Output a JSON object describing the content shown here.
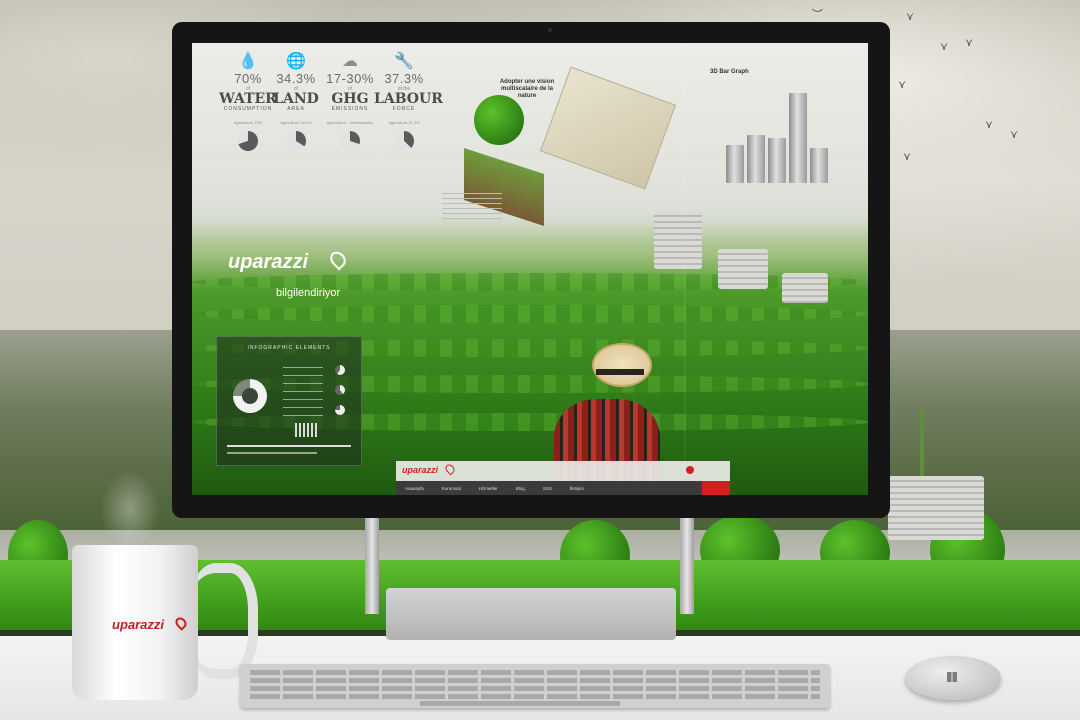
{
  "screen": {
    "stats": [
      {
        "icon": "water-drop-icon",
        "glyph": "💧",
        "percent": "70%",
        "of": "of",
        "title": "WATER",
        "subtitle": "CONSUMPTION",
        "note": "Agriculture 70%",
        "fill": 0.7
      },
      {
        "icon": "globe-icon",
        "glyph": "🌐",
        "percent": "34.3%",
        "of": "of",
        "title": "LAND",
        "subtitle": "AREA",
        "note": "Agriculture 34.3%",
        "fill": 0.343
      },
      {
        "icon": "cloud-icon",
        "glyph": "☁",
        "percent": "17-30%",
        "of": "of",
        "title": "GHG",
        "subtitle": "EMISSIONS",
        "note": "Agriculture · Deforestation",
        "fill": 0.3
      },
      {
        "icon": "wrench-icon",
        "glyph": "🔧",
        "percent": "37.3%",
        "of": "of the",
        "title": "LABOUR",
        "subtitle": "FORCE",
        "note": "Agriculture 37.3%",
        "fill": 0.373
      }
    ],
    "vision_title": "Adopter une vision multiscalaire de la nature",
    "chart_title": "3D Bar Graph",
    "chart_bar_levels": [
      0.38,
      0.48,
      0.45,
      0.9,
      0.35
    ],
    "brand": "uparazzi",
    "tagline": "bilgilendiriyor",
    "infographic_title": "INFOGRAPHIC ELEMENTS",
    "navbar": {
      "logo": "uparazzi",
      "menu": [
        "Anasayfa",
        "Kurumsal",
        "Hizmetler",
        "Blog",
        "SSS",
        "İletişim"
      ]
    }
  },
  "mug": {
    "logo": "uparazzi"
  },
  "colors": {
    "accent_red": "#d21f1f",
    "grass": "#4aa524",
    "monitor_frame": "#151515"
  }
}
